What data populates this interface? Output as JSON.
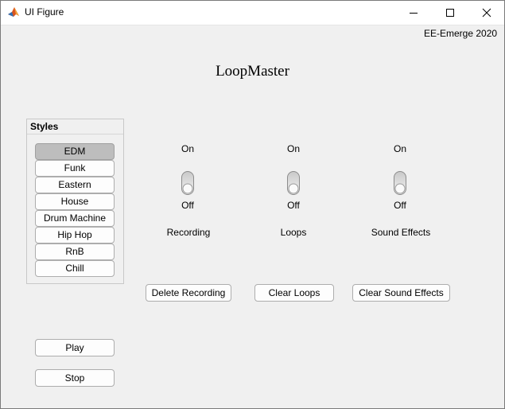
{
  "window": {
    "title": "UI Figure",
    "icon": "matlab-icon",
    "controls": [
      "minimize-icon",
      "maximize-icon",
      "close-icon"
    ]
  },
  "header": {
    "credit": "EE-Emerge 2020",
    "title": "LoopMaster"
  },
  "styles_panel": {
    "title": "Styles",
    "items": [
      "EDM",
      "Funk",
      "Eastern",
      "House",
      "Drum Machine",
      "Hip Hop",
      "RnB",
      "Chill"
    ],
    "selected": "EDM"
  },
  "switches": [
    {
      "label": "Recording",
      "on_label": "On",
      "off_label": "Off",
      "state": "Off"
    },
    {
      "label": "Loops",
      "on_label": "On",
      "off_label": "Off",
      "state": "Off"
    },
    {
      "label": "Sound Effects",
      "on_label": "On",
      "off_label": "Off",
      "state": "Off"
    }
  ],
  "actions": {
    "delete_recording": "Delete Recording",
    "clear_loops": "Clear Loops",
    "clear_sound_effects": "Clear Sound Effects"
  },
  "transport": {
    "play": "Play",
    "stop": "Stop"
  }
}
